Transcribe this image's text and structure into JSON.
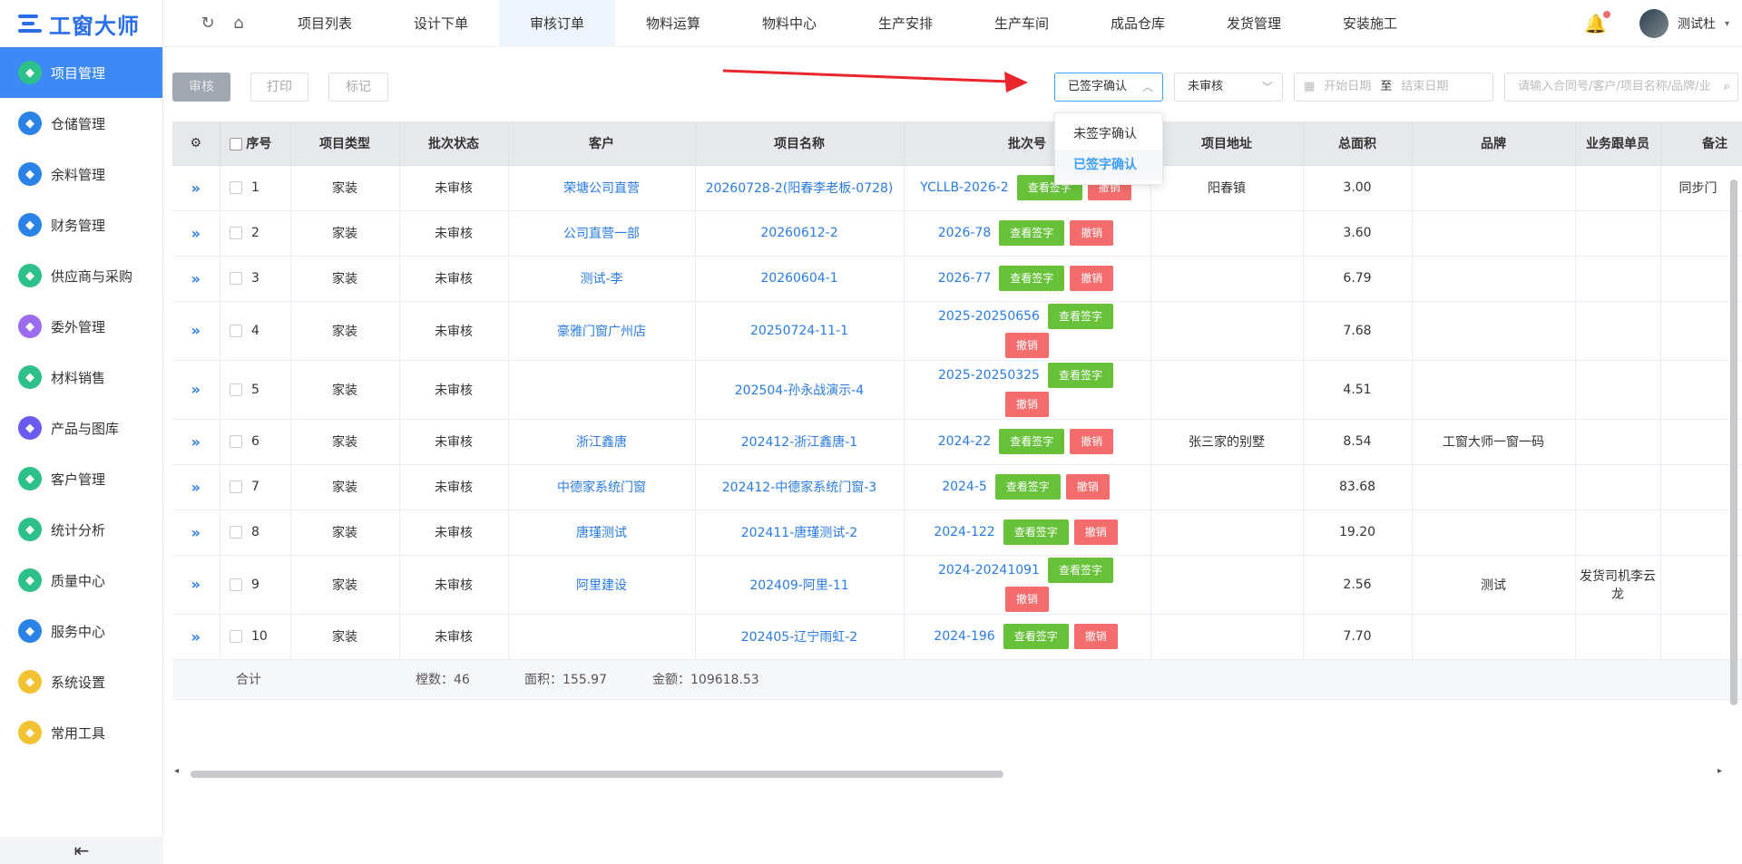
{
  "app": {
    "logo_text": "工窗大师"
  },
  "sidebar": {
    "items": [
      {
        "label": "项目管理",
        "icon": "puzzle-icon",
        "color": "#2ec08a",
        "active": true
      },
      {
        "label": "仓储管理",
        "icon": "stack-icon",
        "color": "#2a82e4"
      },
      {
        "label": "余料管理",
        "icon": "circle-icon",
        "color": "#2a82e4"
      },
      {
        "label": "财务管理",
        "icon": "ledger-icon",
        "color": "#2a82e4"
      },
      {
        "label": "供应商与采购",
        "icon": "note-icon",
        "color": "#2ec08a"
      },
      {
        "label": "委外管理",
        "icon": "stack-icon",
        "color": "#9b6cf0"
      },
      {
        "label": "材料销售",
        "icon": "bag-icon",
        "color": "#2ec08a"
      },
      {
        "label": "产品与图库",
        "icon": "grid-icon",
        "color": "#6a5af0"
      },
      {
        "label": "客户管理",
        "icon": "user-icon",
        "color": "#2ec08a"
      },
      {
        "label": "统计分析",
        "icon": "chart-icon",
        "color": "#2ec08a"
      },
      {
        "label": "质量中心",
        "icon": "flask-icon",
        "color": "#2ec08a"
      },
      {
        "label": "服务中心",
        "icon": "phone-icon",
        "color": "#2a82e4"
      },
      {
        "label": "系统设置",
        "icon": "settings-icon",
        "color": "#f2c232"
      },
      {
        "label": "常用工具",
        "icon": "tool-icon",
        "color": "#f2c232"
      }
    ]
  },
  "topbar": {
    "tabs": [
      "项目列表",
      "设计下单",
      "审核订单",
      "物料运算",
      "物料中心",
      "生产安排",
      "生产车间",
      "成品仓库",
      "发货管理",
      "安装施工"
    ],
    "active_tab": 2,
    "username": "测试杜"
  },
  "toolbar": {
    "audit": "审核",
    "print": "打印",
    "mark": "标记",
    "sign_select": "已签字确认",
    "status_select": "未审核",
    "date_start": "开始日期",
    "date_sep": "至",
    "date_end": "结束日期",
    "search_placeholder": "请输入合同号/客户/项目名称/品牌/业"
  },
  "dropdown": {
    "options": [
      "未签字确认",
      "已签字确认"
    ],
    "selected": 1
  },
  "table": {
    "headers": [
      "序号",
      "项目类型",
      "批次状态",
      "客户",
      "项目名称",
      "批次号",
      "项目地址",
      "总面积",
      "品牌",
      "业务跟单员",
      "备注"
    ],
    "view_sign": "查看签字",
    "revoke": "撤销",
    "rows": [
      {
        "no": "1",
        "type": "家装",
        "status": "未审核",
        "customer": "荣塘公司直营",
        "project": "20260728-2(阳春李老板-0728)",
        "batch": "YCLLB-2026-2",
        "address": "阳春镇",
        "area": "3.00",
        "brand": "",
        "sales": "",
        "remark": "同步门"
      },
      {
        "no": "2",
        "type": "家装",
        "status": "未审核",
        "customer": "公司直营一部",
        "project": "20260612-2",
        "batch": "2026-78",
        "address": "",
        "area": "3.60",
        "brand": "",
        "sales": "",
        "remark": ""
      },
      {
        "no": "3",
        "type": "家装",
        "status": "未审核",
        "customer": "测试-李",
        "project": "20260604-1",
        "batch": "2026-77",
        "address": "",
        "area": "6.79",
        "brand": "",
        "sales": "",
        "remark": ""
      },
      {
        "no": "4",
        "type": "家装",
        "status": "未审核",
        "customer": "豪雅门窗广州店",
        "project": "20250724-11-1",
        "batch": "2025-20250656",
        "address": "",
        "area": "7.68",
        "brand": "",
        "sales": "",
        "remark": ""
      },
      {
        "no": "5",
        "type": "家装",
        "status": "未审核",
        "customer": "",
        "project": "202504-孙永战演示-4",
        "batch": "2025-20250325",
        "address": "",
        "area": "4.51",
        "brand": "",
        "sales": "",
        "remark": ""
      },
      {
        "no": "6",
        "type": "家装",
        "status": "未审核",
        "customer": "浙江鑫唐",
        "project": "202412-浙江鑫唐-1",
        "batch": "2024-22",
        "address": "张三家的别墅",
        "area": "8.54",
        "brand": "工窗大师一窗一码",
        "sales": "",
        "remark": ""
      },
      {
        "no": "7",
        "type": "家装",
        "status": "未审核",
        "customer": "中德家系统门窗",
        "project": "202412-中德家系统门窗-3",
        "batch": "2024-5",
        "address": "",
        "area": "83.68",
        "brand": "",
        "sales": "",
        "remark": ""
      },
      {
        "no": "8",
        "type": "家装",
        "status": "未审核",
        "customer": "唐瑾测试",
        "project": "202411-唐瑾测试-2",
        "batch": "2024-122",
        "address": "",
        "area": "19.20",
        "brand": "",
        "sales": "",
        "remark": ""
      },
      {
        "no": "9",
        "type": "家装",
        "status": "未审核",
        "customer": "阿里建设",
        "project": "202409-阿里-11",
        "batch": "2024-20241091",
        "address": "",
        "area": "2.56",
        "brand": "测试",
        "sales": "发货司机李云龙",
        "remark": ""
      },
      {
        "no": "10",
        "type": "家装",
        "status": "未审核",
        "customer": "",
        "project": "202405-辽宁雨虹-2",
        "batch": "2024-196",
        "address": "",
        "area": "7.70",
        "brand": "",
        "sales": "",
        "remark": ""
      }
    ],
    "footer": {
      "total_label": "合计",
      "count": "樘数：46",
      "area": "面积：155.97",
      "amount": "金额：109618.53"
    }
  }
}
